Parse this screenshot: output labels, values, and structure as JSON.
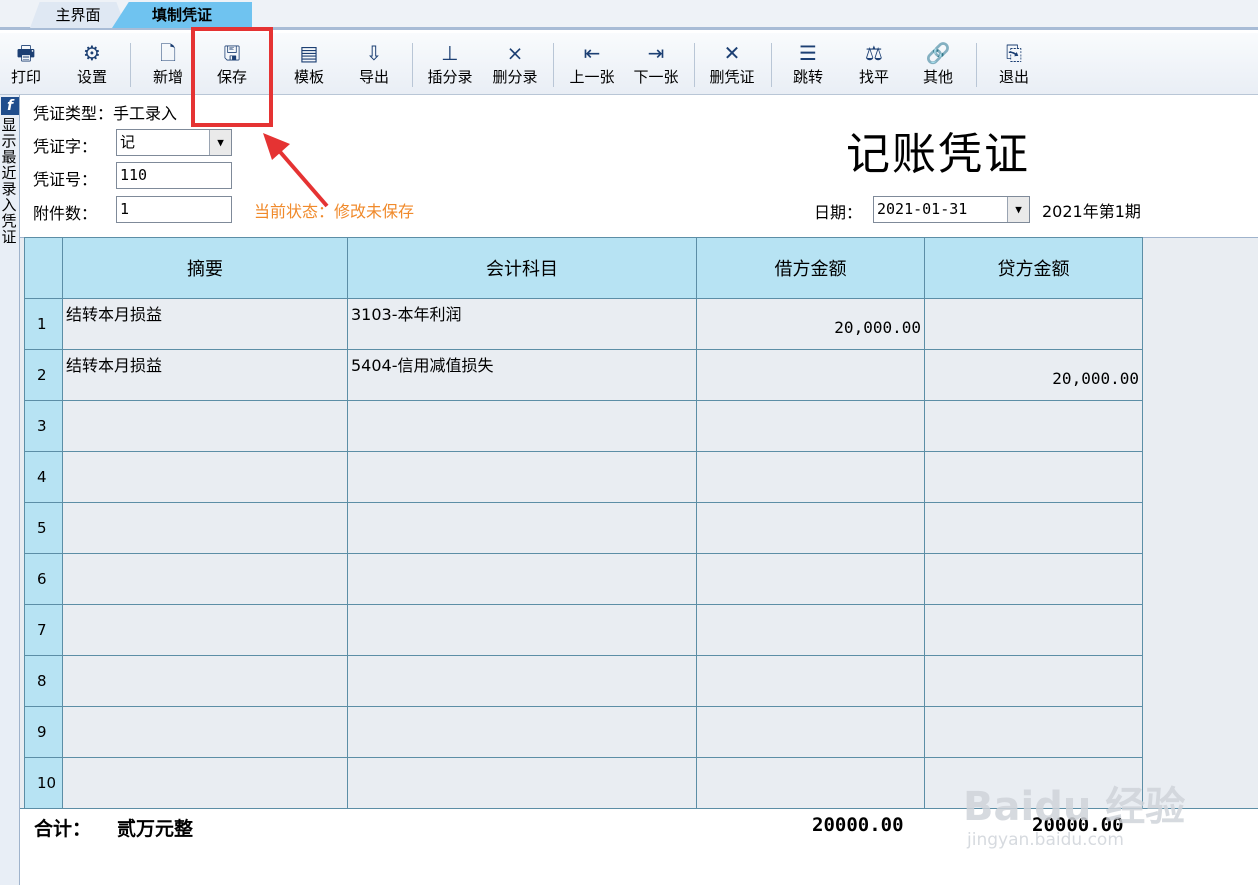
{
  "tabs": [
    {
      "label": "主界面"
    },
    {
      "label": "填制凭证"
    }
  ],
  "toolbar": {
    "buttons": [
      {
        "label": "打印",
        "icon": "printer-icon"
      },
      {
        "label": "设置",
        "icon": "settings-icon"
      },
      {
        "label": "新增",
        "icon": "new-document-icon"
      },
      {
        "label": "保存",
        "icon": "save-icon"
      },
      {
        "label": "模板",
        "icon": "template-icon"
      },
      {
        "label": "导出",
        "icon": "export-icon"
      },
      {
        "label": "插分录",
        "icon": "insert-row-icon"
      },
      {
        "label": "删分录",
        "icon": "delete-row-icon"
      },
      {
        "label": "上一张",
        "icon": "prev-icon"
      },
      {
        "label": "下一张",
        "icon": "next-icon"
      },
      {
        "label": "删凭证",
        "icon": "delete-voucher-icon"
      },
      {
        "label": "跳转",
        "icon": "jump-icon"
      },
      {
        "label": "找平",
        "icon": "balance-icon"
      },
      {
        "label": "其他",
        "icon": "link-icon"
      },
      {
        "label": "退出",
        "icon": "exit-icon"
      }
    ]
  },
  "sidebar": {
    "badge": "f",
    "text": "显示最近录入凭证"
  },
  "form": {
    "type_label": "凭证类型：",
    "type_value": "手工录入",
    "word_label": "凭证字：",
    "word_value": "记",
    "number_label": "凭证号：",
    "number_value": "110",
    "attach_label": "附件数：",
    "attach_value": "1",
    "status_label": "当前状态：",
    "status_value": "修改未保存",
    "date_label": "日期：",
    "date_value": "2021-01-31",
    "period": "2021年第1期"
  },
  "title": "记账凭证",
  "grid": {
    "headers": [
      "摘要",
      "会计科目",
      "借方金额",
      "贷方金额"
    ],
    "rows": [
      {
        "idx": "1",
        "summary": "结转本月损益",
        "account": "3103-本年利润",
        "debit": "20,000.00",
        "credit": ""
      },
      {
        "idx": "2",
        "summary": "结转本月损益",
        "account": "5404-信用减值损失",
        "debit": "",
        "credit": "20,000.00"
      },
      {
        "idx": "3",
        "summary": "",
        "account": "",
        "debit": "",
        "credit": ""
      },
      {
        "idx": "4",
        "summary": "",
        "account": "",
        "debit": "",
        "credit": ""
      },
      {
        "idx": "5",
        "summary": "",
        "account": "",
        "debit": "",
        "credit": ""
      },
      {
        "idx": "6",
        "summary": "",
        "account": "",
        "debit": "",
        "credit": ""
      },
      {
        "idx": "7",
        "summary": "",
        "account": "",
        "debit": "",
        "credit": ""
      },
      {
        "idx": "8",
        "summary": "",
        "account": "",
        "debit": "",
        "credit": ""
      },
      {
        "idx": "9",
        "summary": "",
        "account": "",
        "debit": "",
        "credit": ""
      },
      {
        "idx": "10",
        "summary": "",
        "account": "",
        "debit": "",
        "credit": ""
      }
    ]
  },
  "totals": {
    "label": "合计：",
    "words": "贰万元整",
    "debit": "20000.00",
    "credit": "20000.00"
  },
  "watermark": {
    "big": "Baidu 经验",
    "small": "jingyan.baidu.com"
  },
  "colors": {
    "header_bg": "#b7e3f3",
    "active_tab": "#6fc3f0",
    "status": "#f08a2b",
    "highlight": "#e53333"
  }
}
